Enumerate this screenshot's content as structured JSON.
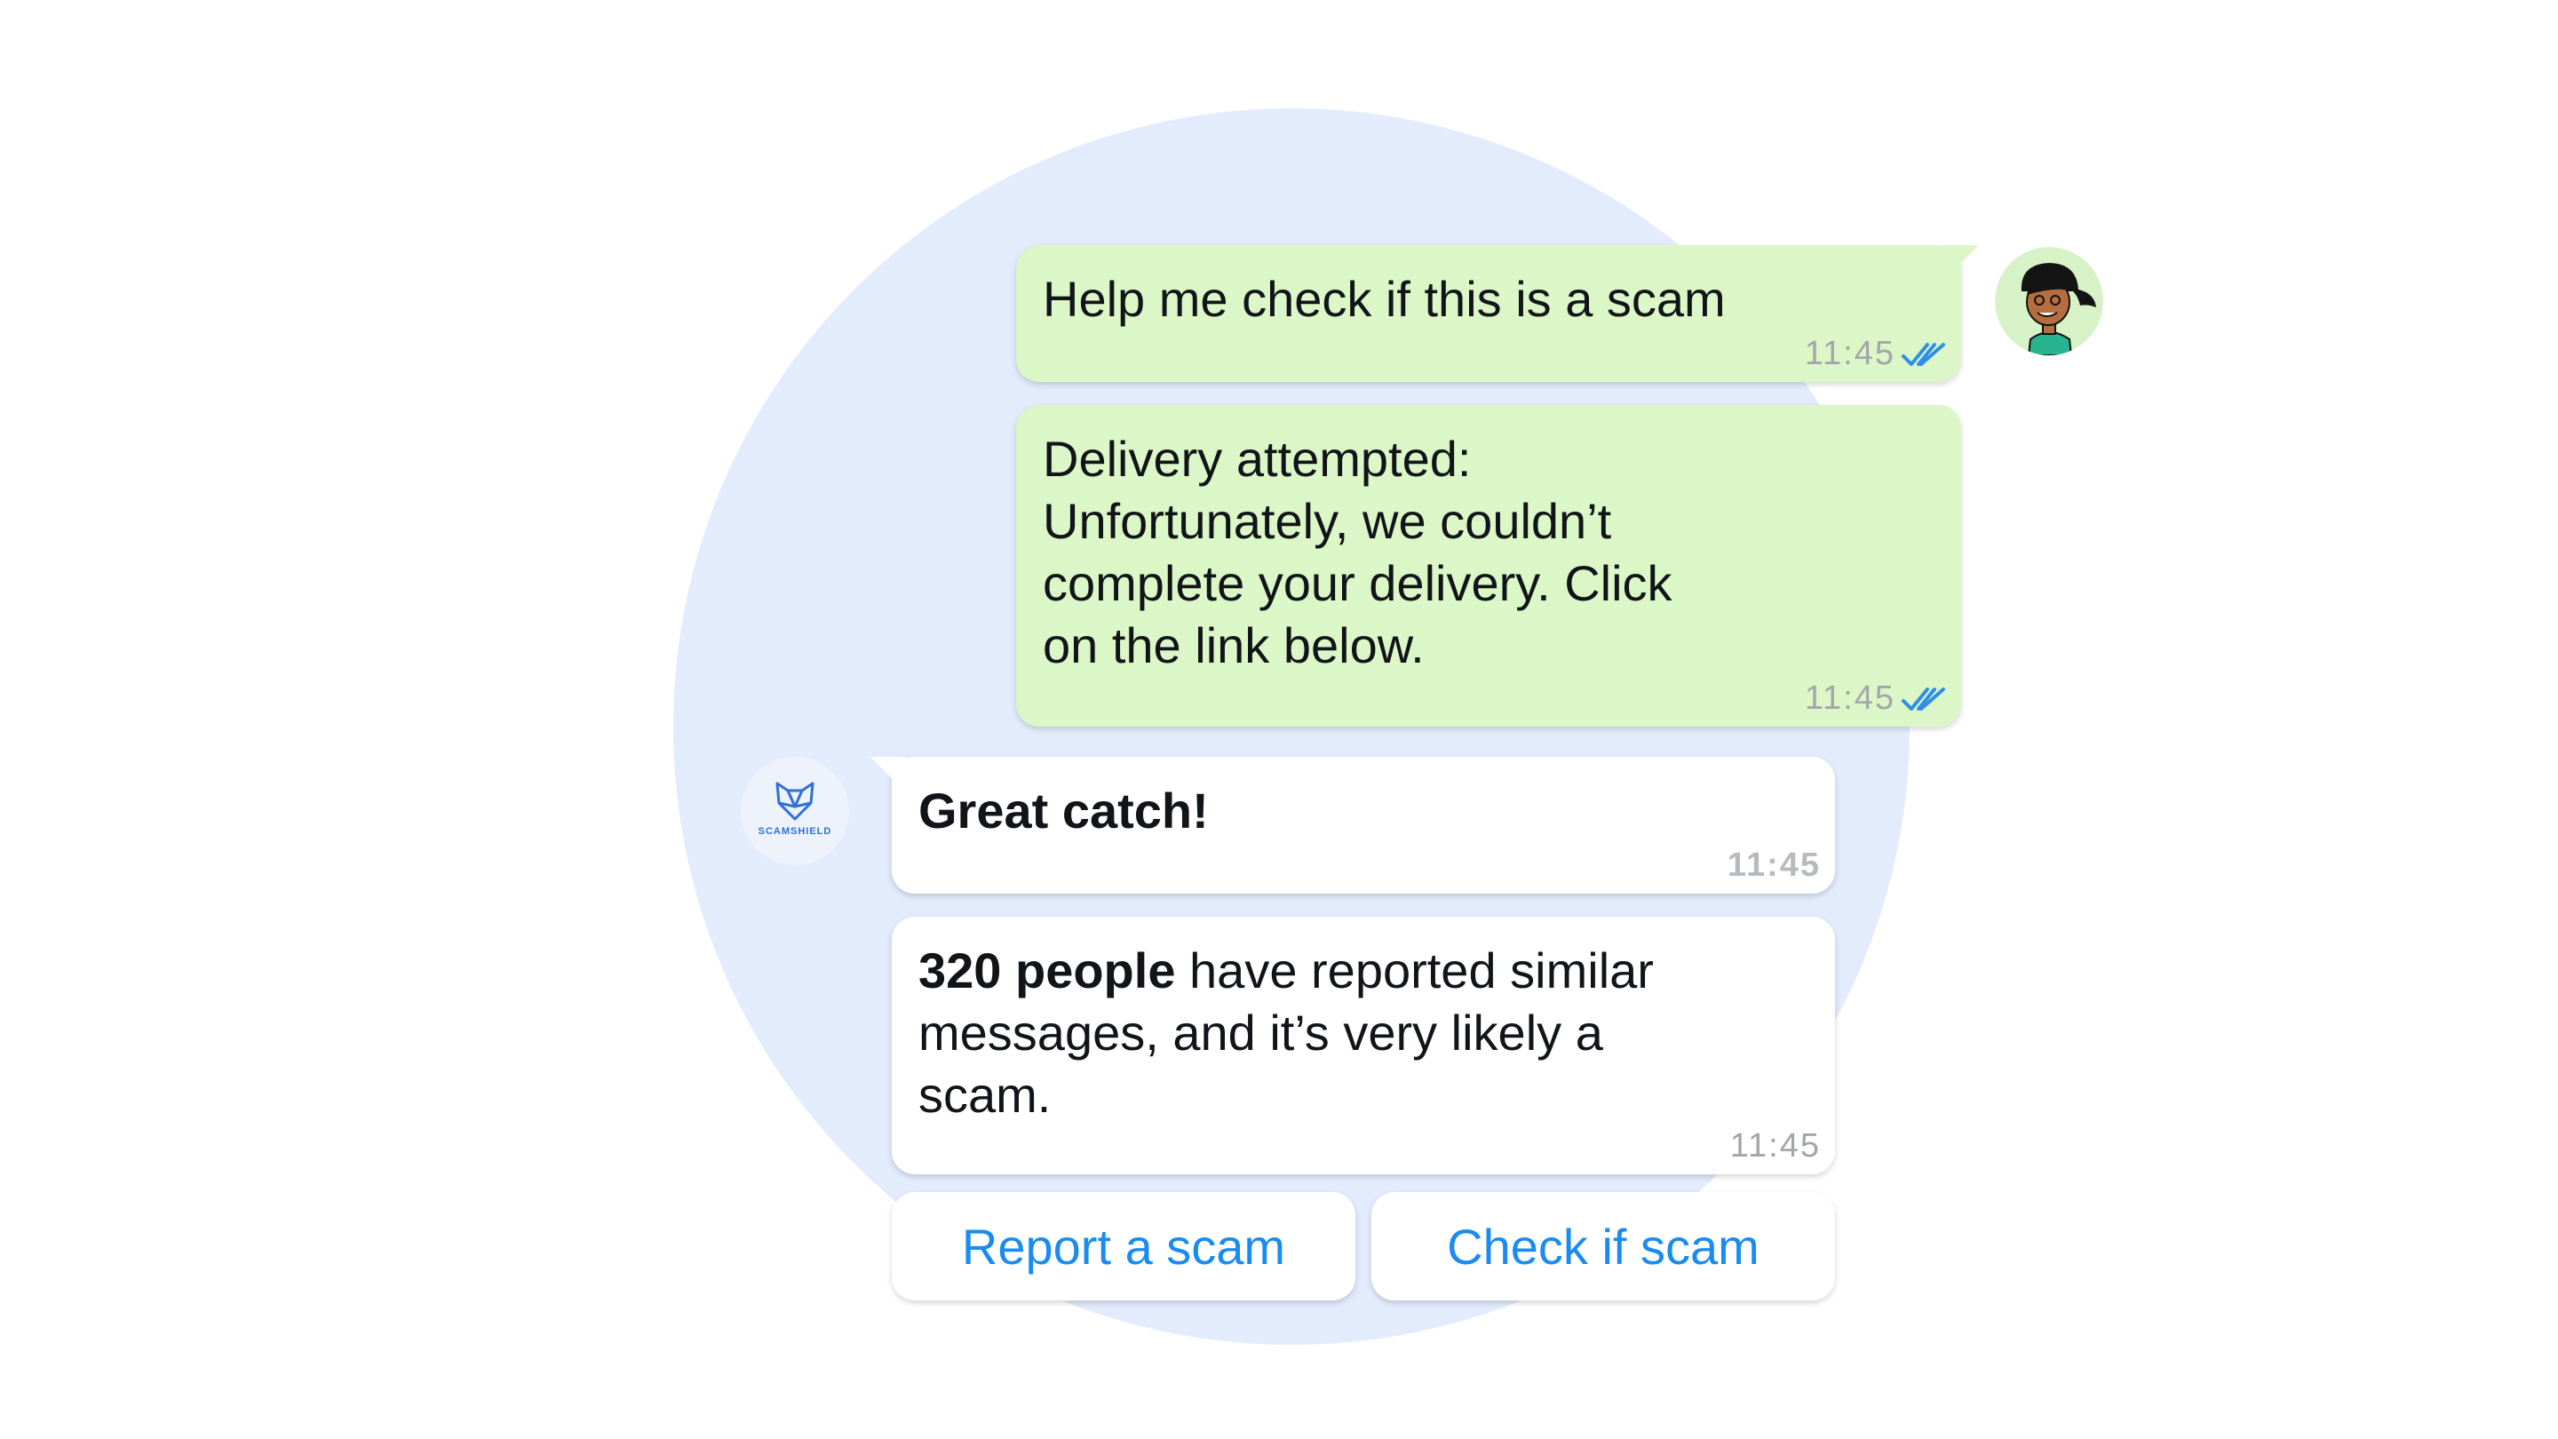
{
  "conversation": {
    "outgoing": [
      {
        "text": "Help me check if this is a scam",
        "time": "11:45",
        "status": "read"
      },
      {
        "text": "Delivery attempted: Unfortunately, we couldn’t complete your delivery. Click on the link below.",
        "time": "11:45",
        "status": "read"
      }
    ],
    "incoming": [
      {
        "text": "Great catch!",
        "time": "11:45"
      },
      {
        "bold": "320 people",
        "text": " have reported similar messages, and it’s very likely a scam.",
        "time": "11:45"
      }
    ]
  },
  "bot": {
    "name": "SCAMSHIELD"
  },
  "quick_replies": {
    "report": "Report a scam",
    "check": "Check if scam"
  },
  "colors": {
    "outgoing_bubble": "#dcf7c7",
    "incoming_bubble": "#ffffff",
    "background_circle": "#e2ecfc",
    "link_blue": "#1a8cf0",
    "tick_blue": "#2f8fe6"
  }
}
